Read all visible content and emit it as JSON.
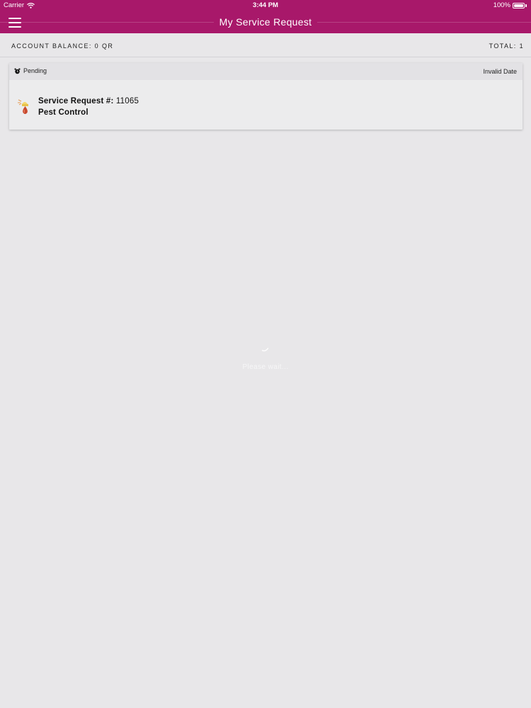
{
  "status_bar": {
    "carrier": "Carrier",
    "time": "3:44 PM",
    "battery": "100%"
  },
  "header": {
    "title": "My Service Request"
  },
  "summary": {
    "account_balance": "ACCOUNT BALANCE: 0 QR",
    "total": "TOTAL: 1"
  },
  "requests": [
    {
      "status": "Pending",
      "date": "Invalid Date",
      "number_label": "Service Request #:",
      "number": "11065",
      "service": "Pest Control"
    }
  ],
  "loader": {
    "message": "Please wait..."
  },
  "colors": {
    "brand": "#a8186a",
    "background": "#e8e7e9"
  },
  "icons": [
    "wifi-icon",
    "battery-icon",
    "menu-icon",
    "alarm-clock-icon",
    "pest-control-icon",
    "spinner-icon"
  ]
}
